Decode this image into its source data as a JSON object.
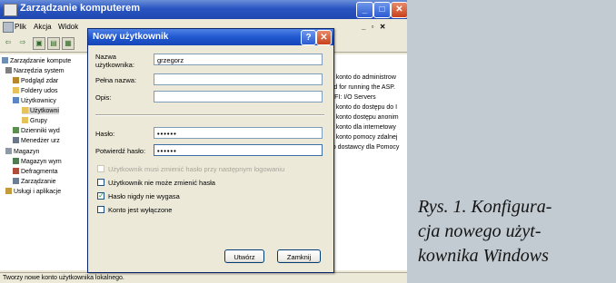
{
  "mmc": {
    "title": "Zarządzanie komputerem",
    "menu": [
      "Plik",
      "Akcja",
      "Widok"
    ],
    "tree": [
      {
        "label": "Zarządzanie kompute",
        "icon": "computer-icon"
      },
      {
        "label": "Narzędzia system",
        "icon": "tools-icon"
      },
      {
        "label": "Podgląd zdar",
        "icon": "event-viewer-icon"
      },
      {
        "label": "Foldery udos",
        "icon": "shared-folder-icon"
      },
      {
        "label": "Użytkownicy",
        "icon": "users-icon"
      },
      {
        "label": "Użytkowni",
        "icon": "folder-icon"
      },
      {
        "label": "Grupy",
        "icon": "folder-icon"
      },
      {
        "label": "Dzienniki wyd",
        "icon": "logs-icon"
      },
      {
        "label": "Menedżer urz",
        "icon": "device-manager-icon"
      },
      {
        "label": "Magazyn",
        "icon": "storage-icon"
      },
      {
        "label": "Magazyn wym",
        "icon": "removable-storage-icon"
      },
      {
        "label": "Defragmenta",
        "icon": "defrag-icon"
      },
      {
        "label": "Zarządzanie",
        "icon": "disk-management-icon"
      },
      {
        "label": "Usługi i aplikacje",
        "icon": "services-icon"
      }
    ],
    "right_lines": [
      "ne konto do administrow",
      "sed for running the ASP.",
      "or FI: I/O Servers",
      "ne konto do dostępu do I",
      "ne konto dostępu anonim",
      "ne konto dla internetowy",
      "ne konto pomocy zdalnej",
      "nto dostawcy dla Pomocy"
    ],
    "status": "Tworzy nowe konto użytkownika lokalnego."
  },
  "dialog": {
    "title": "Nowy użytkownik",
    "help_label": "?",
    "close_label": "✕",
    "username_label": "Nazwa użytkownika:",
    "username_value": "grzegorz",
    "fullname_label": "Pełna nazwa:",
    "fullname_value": "",
    "description_label": "Opis:",
    "description_value": "",
    "password_label": "Hasło:",
    "password_value": "••••••",
    "confirm_label": "Potwierdź hasło:",
    "confirm_value": "••••••",
    "options": [
      {
        "label": "Użytkownik musi zmienić hasło przy następnym logowaniu",
        "checked": false,
        "enabled": false
      },
      {
        "label": "Użytkownik nie może zmienić hasła",
        "checked": false,
        "enabled": true
      },
      {
        "label": "Hasło nigdy nie wygasa",
        "checked": true,
        "enabled": true
      },
      {
        "label": "Konto jest wyłączone",
        "checked": false,
        "enabled": true
      }
    ],
    "create_button": "Utwórz",
    "close_button": "Zamknij"
  },
  "caption": {
    "lines": [
      "Rys. 1. Konfigura-",
      "cja nowego użyt-",
      "kownika Windows"
    ]
  },
  "colors": {
    "titlebar": "#2058cf",
    "dialog_bg": "#ece9d8",
    "field_border": "#7f9db9",
    "close_button": "#c8411b",
    "caption_panel": "#c3cbd2"
  }
}
